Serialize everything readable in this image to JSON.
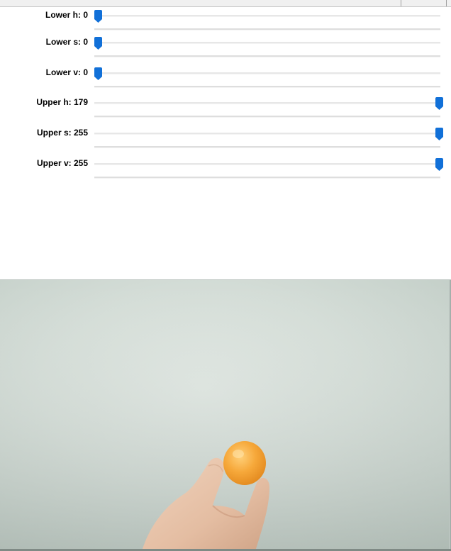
{
  "trackbars": [
    {
      "label": "Lower h: 0",
      "value": 0,
      "max": 179
    },
    {
      "label": "Lower s: 0",
      "value": 0,
      "max": 255
    },
    {
      "label": "Lower v: 0",
      "value": 0,
      "max": 255
    },
    {
      "label": "Upper h: 179",
      "value": 179,
      "max": 179
    },
    {
      "label": "Upper s: 255",
      "value": 255,
      "max": 255
    },
    {
      "label": "Upper v: 255",
      "value": 255,
      "max": 255
    }
  ],
  "colors": {
    "thumb": "#1170d8",
    "camera_background": "#d6ded9",
    "ball": "#f6a83a",
    "hand": "#e8c2a8"
  },
  "camera": {
    "subject": "orange ball held between fingers"
  }
}
